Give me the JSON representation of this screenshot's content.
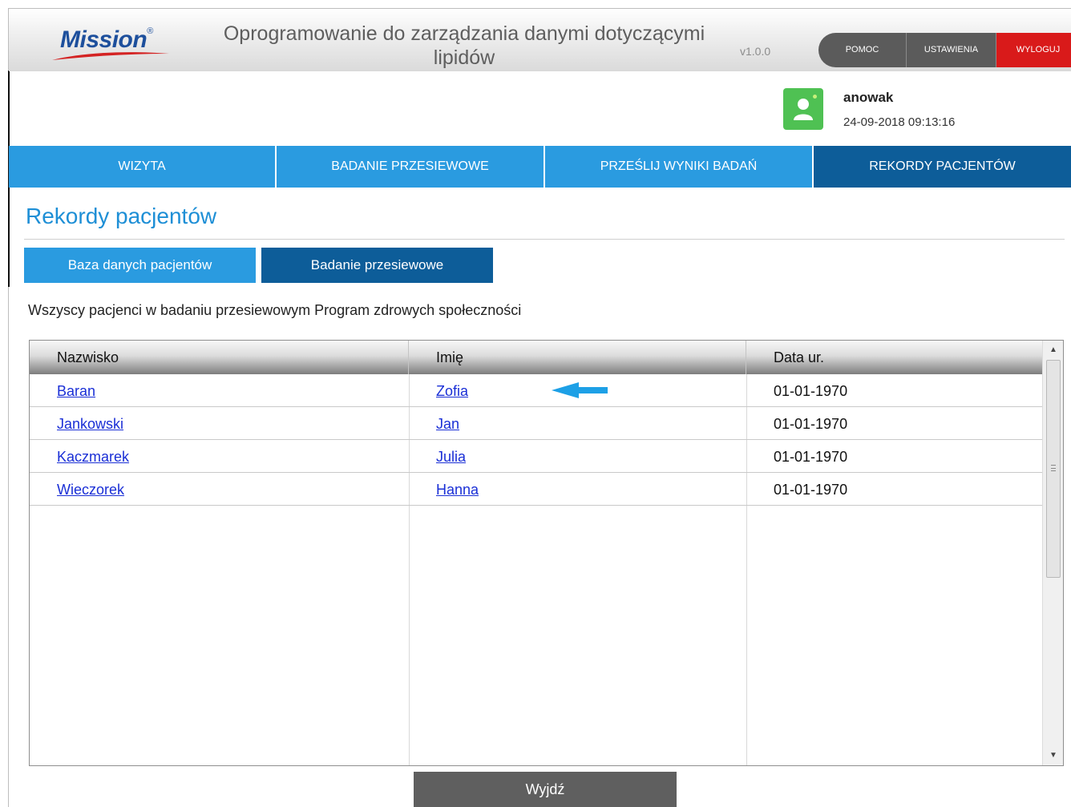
{
  "header": {
    "logo_text": "Mission",
    "logo_reg": "®",
    "title_line1": "Oprogramowanie do zarządzania danymi dotyczącymi",
    "title_line2": "lipidów",
    "version": "v1.0.0",
    "buttons": {
      "help": "POMOC",
      "settings": "USTAWIENIA",
      "logout": "WYLOGUJ"
    },
    "colors": {
      "brand_blue": "#1d4f9c",
      "logout_red": "#d91a1a"
    }
  },
  "user": {
    "icon": "user-avatar-icon",
    "username": "anowak",
    "datetime": "24-09-2018 09:13:16"
  },
  "nav": {
    "tabs": [
      {
        "label": "WIZYTA"
      },
      {
        "label": "BADANIE PRZESIEWOWE"
      },
      {
        "label": "PRZEŚLIJ WYNIKI BADAŃ"
      },
      {
        "label": "REKORDY PACJENTÓW",
        "active": true
      }
    ],
    "colors": {
      "tab": "#2a9be0",
      "active": "#0d5d99"
    }
  },
  "page": {
    "title": "Rekordy pacjentów",
    "subtabs": [
      {
        "label": "Baza danych pacjentów"
      },
      {
        "label": "Badanie przesiewowe",
        "active": true
      }
    ],
    "caption": "Wszyscy pacjenci w badaniu przesiewowym Program zdrowych społeczności"
  },
  "table": {
    "columns": [
      "Nazwisko",
      "Imię",
      "Data ur."
    ],
    "rows": [
      {
        "last": "Baran",
        "first": "Zofia",
        "dob": "01-01-1970"
      },
      {
        "last": "Jankowski",
        "first": "Jan",
        "dob": "01-01-1970"
      },
      {
        "last": "Kaczmarek",
        "first": "Julia",
        "dob": "01-01-1970"
      },
      {
        "last": "Wieczorek",
        "first": "Hanna",
        "dob": "01-01-1970"
      }
    ]
  },
  "footer": {
    "exit_label": "Wyjdź"
  }
}
